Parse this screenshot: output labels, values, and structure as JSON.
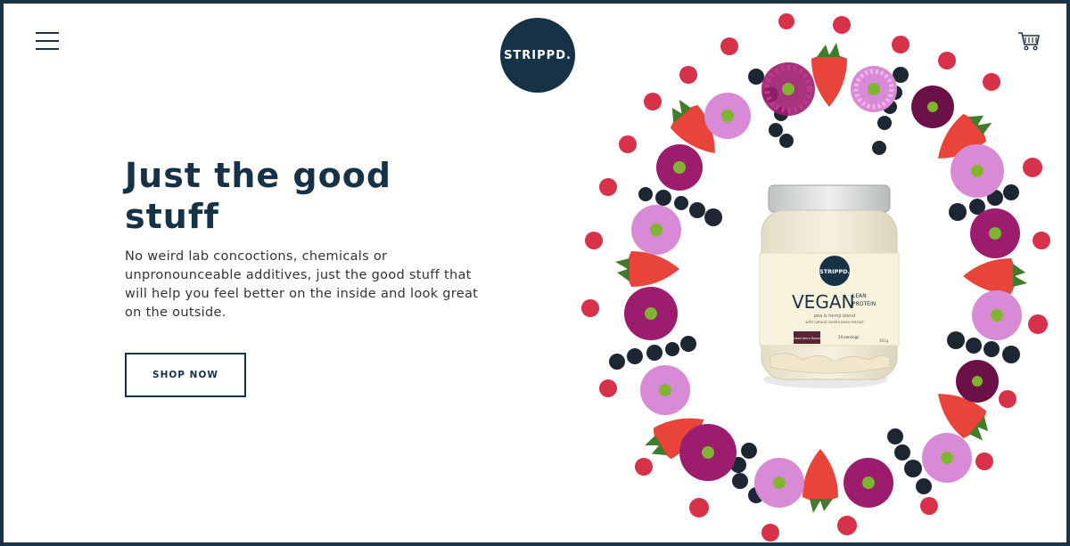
{
  "header": {
    "menu_icon": "hamburger-menu-icon",
    "brand": "STRIPPD.",
    "cart_icon": "shopping-cart-icon"
  },
  "hero": {
    "title": "Just the good stuff",
    "description": "No weird lab concoctions, chemicals or unpronounceable additives, just the good stuff that will help you feel better on the inside and look great on the outside.",
    "cta_label": "SHOP NOW"
  },
  "product": {
    "jar_brand": "STRIPPD.",
    "name": "VEGAN",
    "subtitle_line1": "LEAN",
    "subtitle_line2": "PROTEIN",
    "blend": "pea & hemp blend",
    "note": "with natural vanilla bean extract",
    "flavour": "mixed berry flavour",
    "servings": "14 servings",
    "weight": "392g"
  },
  "colors": {
    "brand_navy": "#163247",
    "frame": "#1b3346",
    "strawberry": "#e8443a",
    "raspberry": "#d8314a",
    "blueberry": "#1d2733",
    "flower_pink": "#d98ad6",
    "flower_magenta": "#9c1d6e",
    "leaf": "#3f7d2d"
  }
}
